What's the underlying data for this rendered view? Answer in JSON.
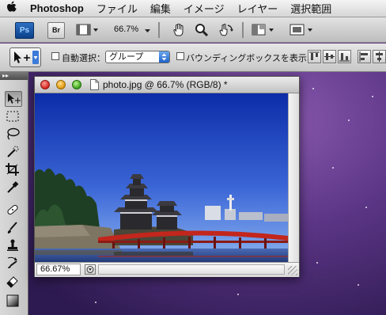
{
  "menubar": {
    "apple_glyph": "",
    "app_name": "Photoshop",
    "items": [
      "ファイル",
      "編集",
      "イメージ",
      "レイヤー",
      "選択範囲"
    ]
  },
  "appbar": {
    "ps_label": "Ps",
    "br_label": "Br",
    "zoom": "66.7%"
  },
  "options": {
    "auto_select_label": "自動選択：",
    "auto_select_value": "グループ",
    "auto_select_checked": false,
    "bounding_box_label": "バウンディングボックスを表示",
    "bounding_box_checked": false
  },
  "toolpanel": {
    "collapse_glyph": "▸▸",
    "tools": [
      "move-tool",
      "marquee-tool",
      "lasso-tool",
      "quick-selection-tool",
      "crop-tool",
      "eyedropper-tool",
      "healing-brush-tool",
      "brush-tool",
      "clone-stamp-tool",
      "history-brush-tool",
      "eraser-tool",
      "gradient-tool"
    ],
    "active_tool": "move-tool"
  },
  "document": {
    "title": "photo.jpg @ 66.7% (RGB/8) *",
    "zoom_field": "66.67%"
  },
  "colors": {
    "sky_top": "#0c2ca8",
    "sky_bottom": "#7fa9ee",
    "bridge": "#c2261c",
    "castle": "#2a2a2e",
    "desktop": "#5b3585"
  }
}
